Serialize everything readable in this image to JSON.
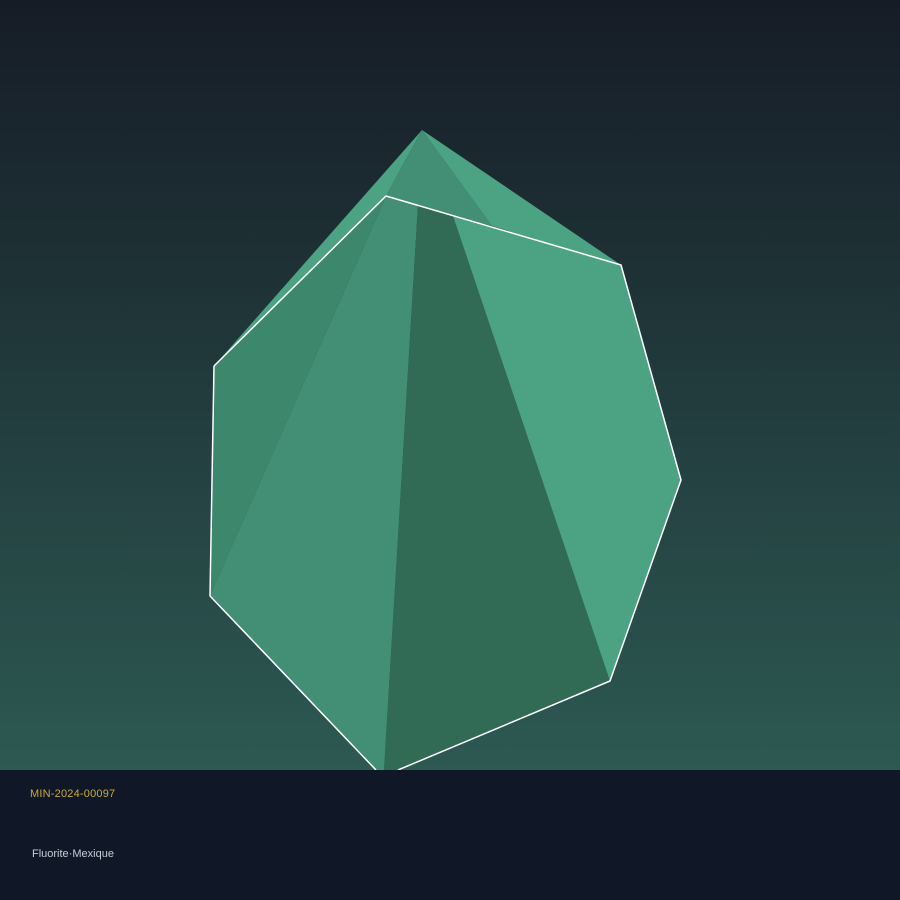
{
  "specimen": {
    "catalog_id": "MIN-2024-00097",
    "mineral": "Fluorite",
    "separator": "·",
    "locality": "Mexique"
  },
  "colors": {
    "background_top": "#161c26",
    "background_bottom": "#2d5952",
    "footer": "#101828",
    "crystal_light": "#4ba384",
    "crystal_mid": "#438f76",
    "crystal_dark": "#316a55",
    "crystal_left": "#3d876d",
    "edge_highlight": "#ffffff",
    "catalog_text": "#c9a93f",
    "caption_text": "#c7ccd6"
  }
}
